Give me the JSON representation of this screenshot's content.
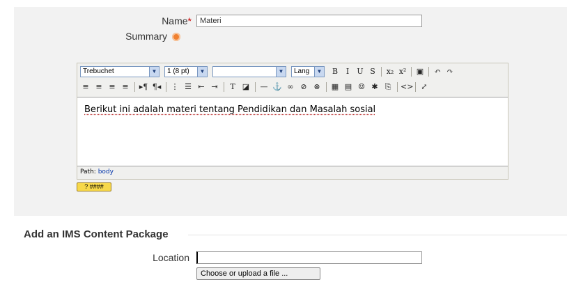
{
  "form": {
    "name_label": "Name",
    "required_mark": "*",
    "name_value": "Materi",
    "summary_label": "Summary",
    "location_label": "Location",
    "location_value": "",
    "choose_button": "Choose or upload a file ..."
  },
  "editor": {
    "font_family": "Trebuchet",
    "font_size": "1 (8 pt)",
    "format": "",
    "lang": "Lang",
    "content": "Berikut ini adalah materi tentang Pendidikan dan Masalah sosial",
    "path_label": "Path:",
    "path_value": "body",
    "toolbar_row1": [
      {
        "name": "bold-icon",
        "glyph": "B"
      },
      {
        "name": "italic-icon",
        "glyph": "I"
      },
      {
        "name": "underline-icon",
        "glyph": "U"
      },
      {
        "name": "strikethrough-icon",
        "glyph": "S"
      },
      {
        "name": "subscript-icon",
        "glyph": "x₂"
      },
      {
        "name": "superscript-icon",
        "glyph": "x²"
      },
      {
        "name": "clean-word-icon",
        "glyph": "▣"
      },
      {
        "name": "undo-icon",
        "glyph": "↶"
      },
      {
        "name": "redo-icon",
        "glyph": "↷"
      }
    ],
    "toolbar_row2": [
      {
        "name": "align-left-icon",
        "glyph": "≡"
      },
      {
        "name": "align-center-icon",
        "glyph": "≡"
      },
      {
        "name": "align-right-icon",
        "glyph": "≡"
      },
      {
        "name": "justify-icon",
        "glyph": "≡"
      },
      {
        "name": "ltr-icon",
        "glyph": "▸¶"
      },
      {
        "name": "rtl-icon",
        "glyph": "¶◂"
      },
      {
        "name": "ordered-list-icon",
        "glyph": "⋮"
      },
      {
        "name": "unordered-list-icon",
        "glyph": "☰"
      },
      {
        "name": "outdent-icon",
        "glyph": "⇤"
      },
      {
        "name": "indent-icon",
        "glyph": "⇥"
      },
      {
        "name": "text-color-icon",
        "glyph": "T"
      },
      {
        "name": "bg-color-icon",
        "glyph": "◪"
      },
      {
        "name": "horizontal-rule-icon",
        "glyph": "—"
      },
      {
        "name": "anchor-icon",
        "glyph": "⚓"
      },
      {
        "name": "link-icon",
        "glyph": "∞"
      },
      {
        "name": "unlink-icon",
        "glyph": "⊘"
      },
      {
        "name": "nolink-icon",
        "glyph": "⊗"
      },
      {
        "name": "image-icon",
        "glyph": "▦"
      },
      {
        "name": "table-icon",
        "glyph": "▤"
      },
      {
        "name": "smiley-icon",
        "glyph": "☺"
      },
      {
        "name": "special-char-icon",
        "glyph": "✱"
      },
      {
        "name": "search-replace-icon",
        "glyph": "⎘"
      },
      {
        "name": "html-source-icon",
        "glyph": "<>"
      },
      {
        "name": "fullscreen-icon",
        "glyph": "⤢"
      }
    ]
  },
  "section": {
    "title": "Add an IMS Content Package"
  }
}
